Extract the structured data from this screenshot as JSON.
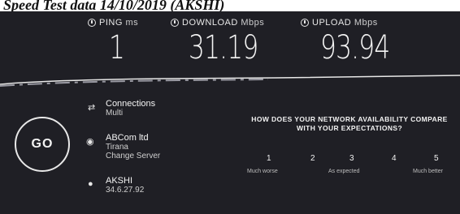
{
  "caption": "Speed Test data 14/10/2019 (AKSHI)",
  "metrics": {
    "ping": {
      "label_main": "PING",
      "label_unit": "ms",
      "value": "1",
      "icon": "ping-icon"
    },
    "download": {
      "label_main": "DOWNLOAD",
      "label_unit": "Mbps",
      "value": "31.19",
      "icon": "download-icon"
    },
    "upload": {
      "label_main": "UPLOAD",
      "label_unit": "Mbps",
      "value": "93.94",
      "icon": "upload-icon"
    }
  },
  "go_label": "GO",
  "connections": {
    "title": "Connections",
    "value": "Multi"
  },
  "provider": {
    "title": "ABCom ltd",
    "location": "Tirana",
    "change_server": "Change Server"
  },
  "client": {
    "title": "AKSHI",
    "ip": "34.6.27.92"
  },
  "survey": {
    "question": "HOW DOES YOUR NETWORK AVAILABILITY COMPARE WITH YOUR EXPECTATIONS?",
    "ratings": [
      "1",
      "2",
      "3",
      "4",
      "5"
    ],
    "scale_labels": {
      "low": "Much worse",
      "mid": "As expected",
      "high": "Much better"
    }
  },
  "colors": {
    "panel": "#1f1f25",
    "text": "#f2f2f2"
  }
}
